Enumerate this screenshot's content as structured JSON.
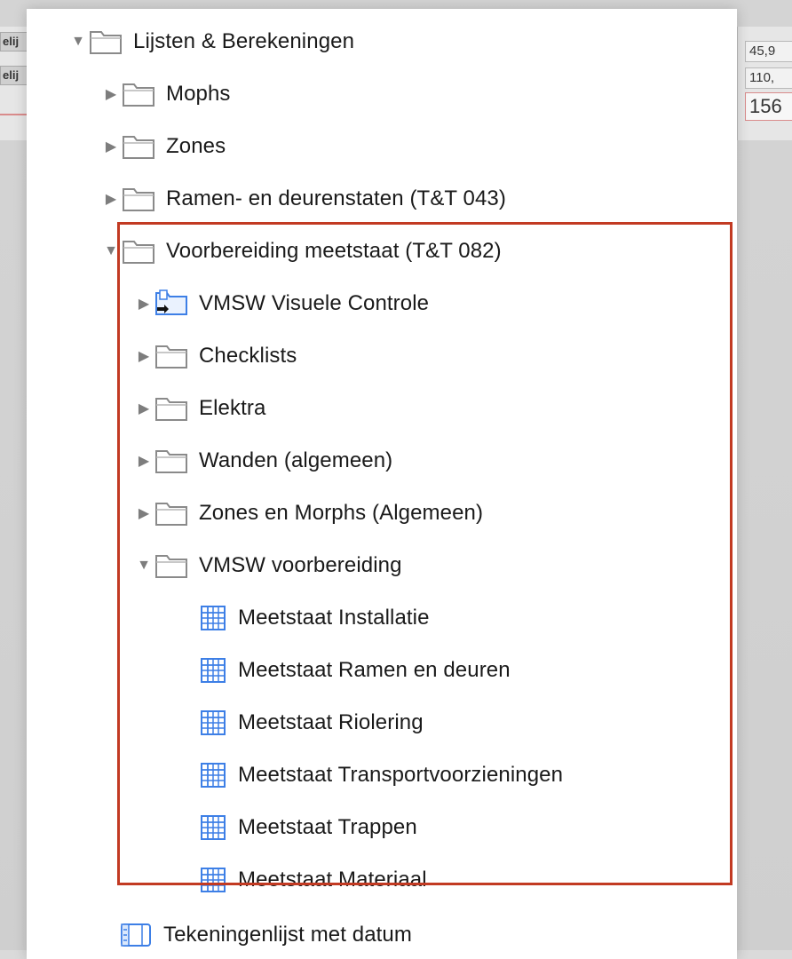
{
  "background": {
    "left_cells": [
      "elij",
      "elij"
    ],
    "right_cells": [
      "45,9",
      "110,",
      "156"
    ]
  },
  "tree": {
    "root": {
      "label": "Lijsten & Berekeningen",
      "icon": "folder-icon",
      "expanded": true
    },
    "items": [
      {
        "label": "Mophs",
        "icon": "folder-icon",
        "expanded": false
      },
      {
        "label": "Zones",
        "icon": "folder-icon",
        "expanded": false
      },
      {
        "label": "Ramen- en deurenstaten (T&T 043)",
        "icon": "folder-icon",
        "expanded": false
      },
      {
        "label": "Voorbereiding meetstaat (T&T 082)",
        "icon": "folder-icon",
        "expanded": true
      },
      {
        "label": "VMSW Visuele Controle",
        "icon": "linked-folder-icon",
        "expanded": false
      },
      {
        "label": "Checklists",
        "icon": "folder-icon",
        "expanded": false
      },
      {
        "label": "Elektra",
        "icon": "folder-icon",
        "expanded": false
      },
      {
        "label": "Wanden (algemeen)",
        "icon": "folder-icon",
        "expanded": false
      },
      {
        "label": "Zones en Morphs (Algemeen)",
        "icon": "folder-icon",
        "expanded": false
      },
      {
        "label": "VMSW voorbereiding",
        "icon": "folder-icon",
        "expanded": true
      },
      {
        "label": "Meetstaat Installatie",
        "icon": "table-icon"
      },
      {
        "label": "Meetstaat Ramen en deuren",
        "icon": "table-icon"
      },
      {
        "label": "Meetstaat Riolering",
        "icon": "table-icon"
      },
      {
        "label": "Meetstaat Transportvoorzieningen",
        "icon": "table-icon"
      },
      {
        "label": "Meetstaat Trappen",
        "icon": "table-icon"
      },
      {
        "label": "Meetstaat Materiaal",
        "icon": "table-icon"
      },
      {
        "label": "Tekeningenlijst met datum",
        "icon": "list-icon"
      }
    ]
  },
  "colors": {
    "highlight_border": "#c23a22",
    "folder_outline": "#8a8a8a",
    "table_icon": "#3d7fe6",
    "disclosure": "#7d7d7d"
  }
}
